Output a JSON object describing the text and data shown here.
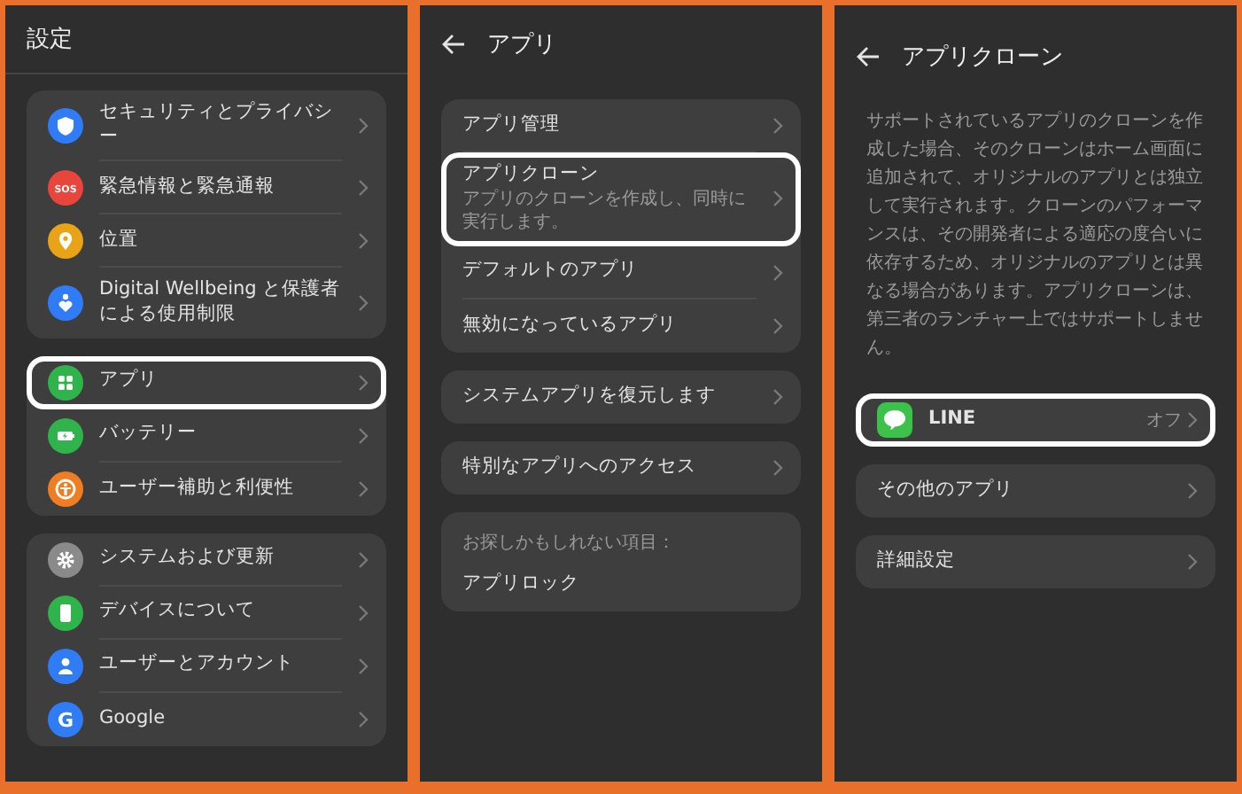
{
  "screens": [
    {
      "title": "設定",
      "back": false,
      "groups": [
        {
          "items": [
            {
              "label": "セキュリティとプライバシー",
              "color": "#2f7cf6",
              "highlighted": false,
              "chevron": true
            },
            {
              "label": "緊急情報と緊急通報",
              "color": "#e8453c",
              "icon_text": "SOS",
              "highlighted": false,
              "chevron": true
            },
            {
              "label": "位置",
              "color": "#e8a317",
              "highlighted": false,
              "chevron": true
            },
            {
              "label": "Digital Wellbeing と保護者による使用制限",
              "color": "#2f7cf6",
              "highlighted": false,
              "chevron": true
            }
          ]
        },
        {
          "items": [
            {
              "label": "アプリ",
              "color": "#2fb34a",
              "highlighted": true,
              "chevron": true
            },
            {
              "label": "バッテリー",
              "color": "#2fb34a",
              "highlighted": false,
              "chevron": true
            },
            {
              "label": "ユーザー補助と利便性",
              "color": "#ef7d22",
              "highlighted": false,
              "chevron": true
            }
          ]
        },
        {
          "items": [
            {
              "label": "システムおよび更新",
              "color": "#8a8a8a",
              "highlighted": false,
              "chevron": true
            },
            {
              "label": "デバイスについて",
              "color": "#2fb34a",
              "highlighted": false,
              "chevron": true
            },
            {
              "label": "ユーザーとアカウント",
              "color": "#2f7cf6",
              "highlighted": false,
              "chevron": true
            },
            {
              "label": "Google",
              "color": "#2f7cf6",
              "icon_text": "G",
              "highlighted": false,
              "chevron": true
            }
          ]
        }
      ]
    },
    {
      "title": "アプリ",
      "back": true,
      "groups": [
        {
          "items": [
            {
              "label": "アプリ管理",
              "highlighted": false,
              "chevron": true
            },
            {
              "label": "アプリクローン",
              "subtitle": "アプリのクローンを作成し、同時に実行します。",
              "highlighted": true,
              "chevron": true
            },
            {
              "label": "デフォルトのアプリ",
              "highlighted": false,
              "chevron": true
            },
            {
              "label": "無効になっているアプリ",
              "highlighted": false,
              "chevron": true
            }
          ]
        },
        {
          "items": [
            {
              "label": "システムアプリを復元します",
              "highlighted": false,
              "chevron": true
            }
          ]
        },
        {
          "items": [
            {
              "label": "特別なアプリへのアクセス",
              "highlighted": false,
              "chevron": true
            }
          ]
        },
        {
          "caption": "お探しかもしれない項目：",
          "items": [
            {
              "label": "アプリロック",
              "highlighted": false,
              "chevron": false
            }
          ]
        }
      ]
    },
    {
      "title": "アプリクローン",
      "back": true,
      "description": "サポートされているアプリのクローンを作成した場合、そのクローンはホーム画面に追加されて、オリジナルのアプリとは独立して実行されます。クローンのパフォーマンスは、その開発者による適応の度合いに依存するため、オリジナルのアプリとは異なる場合があります。アプリクローンは、第三者のランチャー上ではサポートしません。",
      "groups": [
        {
          "items": [
            {
              "label": "LINE",
              "color": "#3cc24a",
              "value": "オフ",
              "highlighted": true,
              "chevron": true
            }
          ]
        },
        {
          "items": [
            {
              "label": "その他のアプリ",
              "highlighted": false,
              "chevron": true
            }
          ]
        },
        {
          "items": [
            {
              "label": "詳細設定",
              "highlighted": false,
              "chevron": true
            }
          ]
        }
      ]
    }
  ]
}
